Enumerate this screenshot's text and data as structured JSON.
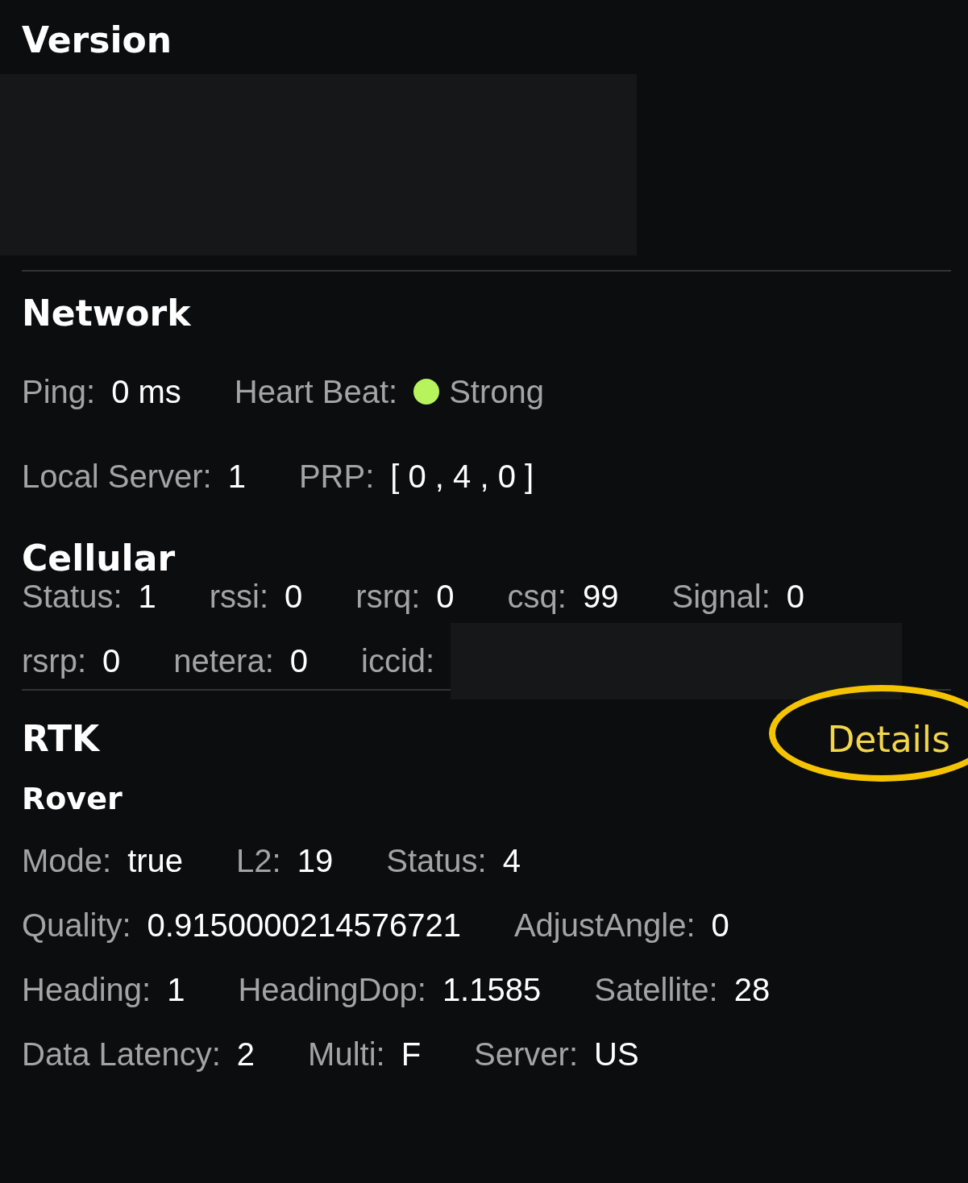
{
  "version": {
    "title": "Version"
  },
  "network": {
    "title": "Network",
    "rows": [
      [
        {
          "label": "Ping:",
          "value": "0 ms"
        },
        {
          "label": "Heart Beat:",
          "value": "Strong",
          "color": "#b6f35c"
        }
      ],
      [
        {
          "label": "Local Server:",
          "value": "1"
        },
        {
          "label": "PRP:",
          "value": "[ 0 , 4 , 0 ]"
        }
      ]
    ]
  },
  "cellular": {
    "title": "Cellular",
    "rows": [
      [
        {
          "label": "Status:",
          "value": "1"
        },
        {
          "label": "rssi:",
          "value": "0"
        },
        {
          "label": "rsrq:",
          "value": "0"
        },
        {
          "label": "csq:",
          "value": "99"
        },
        {
          "label": "Signal:",
          "value": "0"
        }
      ],
      [
        {
          "label": "rsrp:",
          "value": "0"
        },
        {
          "label": "netera:",
          "value": "0"
        },
        {
          "label": "iccid:",
          "redacted": true
        }
      ]
    ]
  },
  "rtk": {
    "title": "RTK",
    "details_link": "Details",
    "subtitle": "Rover",
    "rows": [
      [
        {
          "label": "Mode:",
          "value": "true"
        },
        {
          "label": "L2:",
          "value": "19"
        },
        {
          "label": "Status:",
          "value": "4"
        }
      ],
      [
        {
          "label": "Quality:",
          "value": "0.9150000214576721"
        },
        {
          "label": "AdjustAngle:",
          "value": "0"
        }
      ],
      [
        {
          "label": "Heading:",
          "value": "1"
        },
        {
          "label": "HeadingDop:",
          "value": "1.1585"
        },
        {
          "label": "Satellite:",
          "value": "28"
        }
      ],
      [
        {
          "label": "Data Latency:",
          "value": "2"
        },
        {
          "label": "Multi:",
          "value": "F"
        },
        {
          "label": "Server:",
          "value": "US"
        }
      ]
    ]
  }
}
